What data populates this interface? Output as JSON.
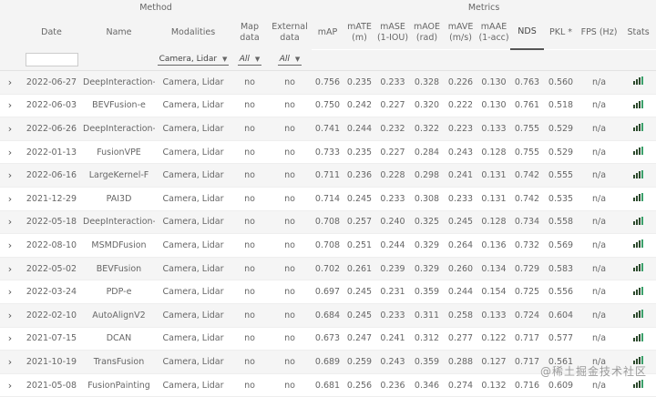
{
  "groups": {
    "method": "Method",
    "metrics": "Metrics"
  },
  "headers": {
    "date": "Date",
    "name": "Name",
    "modalities": "Modalities",
    "map_l1": "Map",
    "map_l2": "data",
    "ext_l1": "External",
    "ext_l2": "data",
    "map": "mAP",
    "mate_l1": "mATE",
    "mate_l2": "(m)",
    "mase_l1": "mASE",
    "mase_l2": "(1-IOU)",
    "maoe_l1": "mAOE",
    "maoe_l2": "(rad)",
    "mave_l1": "mAVE",
    "mave_l2": "(m/s)",
    "maae_l1": "mAAE",
    "maae_l2": "(1-acc)",
    "nds": "NDS",
    "pkl": "PKL *",
    "fps": "FPS (Hz)",
    "stats": "Stats"
  },
  "filters": {
    "date_value": "",
    "modalities": "Camera, Lidar",
    "map_data": "All",
    "external_data": "All"
  },
  "rows": [
    {
      "date": "2022-06-27",
      "name": "DeepInteraction-e",
      "mod": "Camera, Lidar",
      "map_data": "no",
      "ext": "no",
      "mAP": "0.756",
      "mATE": "0.235",
      "mASE": "0.233",
      "mAOE": "0.328",
      "mAVE": "0.226",
      "mAAE": "0.130",
      "NDS": "0.763",
      "PKL": "0.560",
      "FPS": "n/a"
    },
    {
      "date": "2022-06-03",
      "name": "BEVFusion-e",
      "mod": "Camera, Lidar",
      "map_data": "no",
      "ext": "no",
      "mAP": "0.750",
      "mATE": "0.242",
      "mASE": "0.227",
      "mAOE": "0.320",
      "mAVE": "0.222",
      "mAAE": "0.130",
      "NDS": "0.761",
      "PKL": "0.518",
      "FPS": "n/a"
    },
    {
      "date": "2022-06-26",
      "name": "DeepInteraction-lar",
      "mod": "Camera, Lidar",
      "map_data": "no",
      "ext": "no",
      "mAP": "0.741",
      "mATE": "0.244",
      "mASE": "0.232",
      "mAOE": "0.322",
      "mAVE": "0.223",
      "mAAE": "0.133",
      "NDS": "0.755",
      "PKL": "0.529",
      "FPS": "n/a"
    },
    {
      "date": "2022-01-13",
      "name": "FusionVPE",
      "mod": "Camera, Lidar",
      "map_data": "no",
      "ext": "no",
      "mAP": "0.733",
      "mATE": "0.235",
      "mASE": "0.227",
      "mAOE": "0.284",
      "mAVE": "0.243",
      "mAAE": "0.128",
      "NDS": "0.755",
      "PKL": "0.529",
      "FPS": "n/a"
    },
    {
      "date": "2022-06-16",
      "name": "LargeKernel-F",
      "mod": "Camera, Lidar",
      "map_data": "no",
      "ext": "no",
      "mAP": "0.711",
      "mATE": "0.236",
      "mASE": "0.228",
      "mAOE": "0.298",
      "mAVE": "0.241",
      "mAAE": "0.131",
      "NDS": "0.742",
      "PKL": "0.555",
      "FPS": "n/a"
    },
    {
      "date": "2021-12-29",
      "name": "PAI3D",
      "mod": "Camera, Lidar",
      "map_data": "no",
      "ext": "no",
      "mAP": "0.714",
      "mATE": "0.245",
      "mASE": "0.233",
      "mAOE": "0.308",
      "mAVE": "0.233",
      "mAAE": "0.131",
      "NDS": "0.742",
      "PKL": "0.535",
      "FPS": "n/a"
    },
    {
      "date": "2022-05-18",
      "name": "DeepInteraction-ba",
      "mod": "Camera, Lidar",
      "map_data": "no",
      "ext": "no",
      "mAP": "0.708",
      "mATE": "0.257",
      "mASE": "0.240",
      "mAOE": "0.325",
      "mAVE": "0.245",
      "mAAE": "0.128",
      "NDS": "0.734",
      "PKL": "0.558",
      "FPS": "n/a"
    },
    {
      "date": "2022-08-10",
      "name": "MSMDFusion",
      "mod": "Camera, Lidar",
      "map_data": "no",
      "ext": "no",
      "mAP": "0.708",
      "mATE": "0.251",
      "mASE": "0.244",
      "mAOE": "0.329",
      "mAVE": "0.264",
      "mAAE": "0.136",
      "NDS": "0.732",
      "PKL": "0.569",
      "FPS": "n/a"
    },
    {
      "date": "2022-05-02",
      "name": "BEVFusion",
      "mod": "Camera, Lidar",
      "map_data": "no",
      "ext": "no",
      "mAP": "0.702",
      "mATE": "0.261",
      "mASE": "0.239",
      "mAOE": "0.329",
      "mAVE": "0.260",
      "mAAE": "0.134",
      "NDS": "0.729",
      "PKL": "0.583",
      "FPS": "n/a"
    },
    {
      "date": "2022-03-24",
      "name": "PDP-e",
      "mod": "Camera, Lidar",
      "map_data": "no",
      "ext": "no",
      "mAP": "0.697",
      "mATE": "0.245",
      "mASE": "0.231",
      "mAOE": "0.359",
      "mAVE": "0.244",
      "mAAE": "0.154",
      "NDS": "0.725",
      "PKL": "0.556",
      "FPS": "n/a"
    },
    {
      "date": "2022-02-10",
      "name": "AutoAlignV2",
      "mod": "Camera, Lidar",
      "map_data": "no",
      "ext": "no",
      "mAP": "0.684",
      "mATE": "0.245",
      "mASE": "0.233",
      "mAOE": "0.311",
      "mAVE": "0.258",
      "mAAE": "0.133",
      "NDS": "0.724",
      "PKL": "0.604",
      "FPS": "n/a"
    },
    {
      "date": "2021-07-15",
      "name": "DCAN",
      "mod": "Camera, Lidar",
      "map_data": "no",
      "ext": "no",
      "mAP": "0.673",
      "mATE": "0.247",
      "mASE": "0.241",
      "mAOE": "0.312",
      "mAVE": "0.277",
      "mAAE": "0.122",
      "NDS": "0.717",
      "PKL": "0.577",
      "FPS": "n/a"
    },
    {
      "date": "2021-10-19",
      "name": "TransFusion",
      "mod": "Camera, Lidar",
      "map_data": "no",
      "ext": "no",
      "mAP": "0.689",
      "mATE": "0.259",
      "mASE": "0.243",
      "mAOE": "0.359",
      "mAVE": "0.288",
      "mAAE": "0.127",
      "NDS": "0.717",
      "PKL": "0.561",
      "FPS": "n/a"
    },
    {
      "date": "2021-05-08",
      "name": "FusionPainting",
      "mod": "Camera, Lidar",
      "map_data": "no",
      "ext": "no",
      "mAP": "0.681",
      "mATE": "0.256",
      "mASE": "0.236",
      "mAOE": "0.346",
      "mAVE": "0.274",
      "mAAE": "0.132",
      "NDS": "0.716",
      "PKL": "0.609",
      "FPS": "n/a"
    }
  ],
  "icons": {
    "expand": "chevron-right-icon",
    "stats": "bar-chart-icon"
  },
  "watermark": "@稀土掘金技术社区"
}
